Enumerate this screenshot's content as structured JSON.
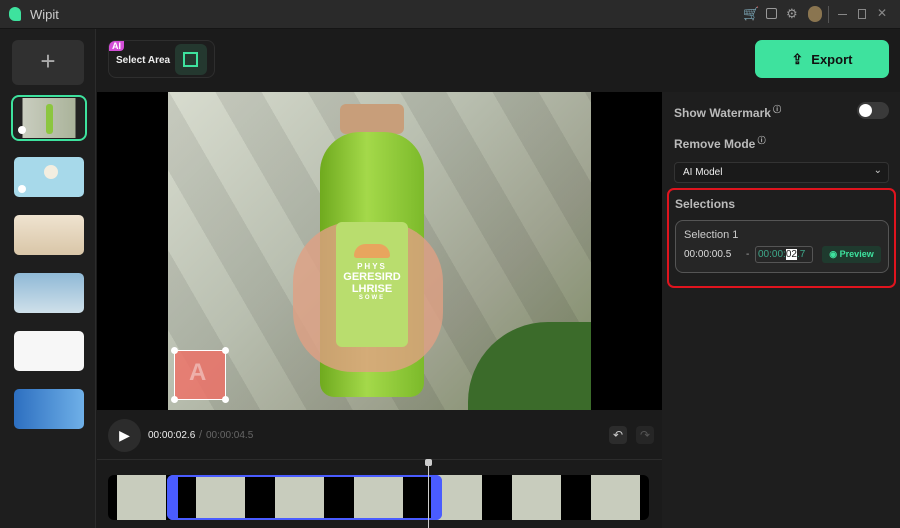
{
  "app": {
    "title": "Wipit"
  },
  "titlebar": {
    "icons": [
      "cart-icon",
      "feedback-icon",
      "settings-icon",
      "avatar-icon",
      "minimize-icon",
      "maximize-icon",
      "close-icon"
    ]
  },
  "toolbar": {
    "ai_badge": "AI",
    "select_area_label": "Select Area",
    "export_label": "Export"
  },
  "sidebar": {
    "add_label": "+",
    "thumbnails": [
      "Juice bottle video",
      "Ice cream video",
      "Cake image",
      "Text image",
      "Document image",
      "Wipit banner image"
    ]
  },
  "video": {
    "label_text": [
      "PHYS",
      "GERESIRD",
      "LHRISE",
      "SOWE"
    ]
  },
  "playback": {
    "current_time": "00:00:02.6",
    "separator": "/",
    "total_time": "00:00:04.5"
  },
  "settings": {
    "show_watermark_label": "Show Watermark",
    "watermark_on": false,
    "remove_mode_label": "Remove Mode",
    "remove_mode_value": "AI Model"
  },
  "selections": {
    "title": "Selections",
    "items": [
      {
        "name": "Selection 1",
        "start": "00:00:00.5",
        "dash": "-",
        "end_prefix": "00:00:",
        "end_highlight": "02",
        "end_suffix": ".7",
        "preview_label": "Preview"
      }
    ]
  },
  "colors": {
    "accent": "#3ee29e",
    "highlight_border": "#e0141e",
    "timeline_selection": "#4a5cff"
  }
}
